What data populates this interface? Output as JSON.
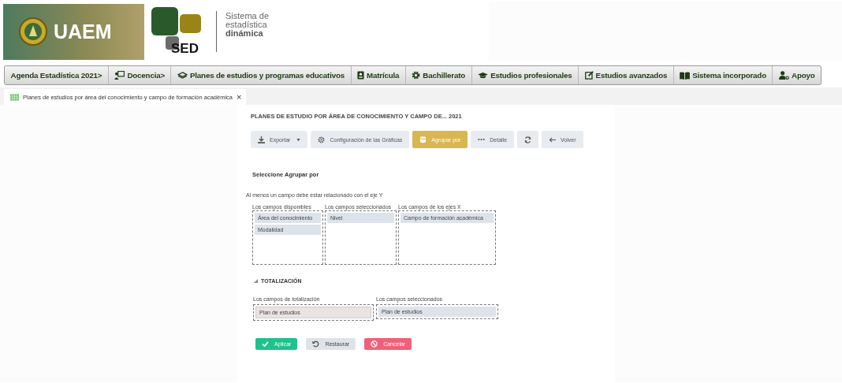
{
  "header": {
    "logo_text": "UAEM",
    "sed_text": "SED",
    "system_name_lines": [
      "Sistema de",
      "estadística"
    ],
    "system_name_bold": "dinámica"
  },
  "nav": [
    {
      "label": "Agenda Estadística 2021>"
    },
    {
      "label": "Docencia>"
    },
    {
      "label": "Planes de estudios y programas educativos"
    },
    {
      "label": "Matrícula"
    },
    {
      "label": "Bachillerato"
    },
    {
      "label": "Estudios profesionales"
    },
    {
      "label": "Estudios avanzados"
    },
    {
      "label": "Sistema incorporado"
    },
    {
      "label": "Apoyo"
    }
  ],
  "tabs": [
    {
      "label": "Planes de estudios por área del conocimiento y campo de formación académica",
      "selected": true,
      "close": "×"
    }
  ],
  "report": {
    "title": "PLANES DE ESTUDIO POR ÁREA DE CONOCIMIENTO Y CAMPO DE... 2021"
  },
  "toolbar": [
    {
      "kind": "dropdown",
      "label": "Exportar",
      "selected": false
    },
    {
      "kind": "button",
      "label": "Configuración de las Gráficas",
      "selected": false
    },
    {
      "kind": "button",
      "label": "Agrupar por",
      "selected": true
    },
    {
      "kind": "button",
      "label": "Detalle",
      "selected": false
    },
    {
      "kind": "icon",
      "selected": false
    },
    {
      "kind": "button",
      "label": "Volver",
      "selected": false
    }
  ],
  "group_by": {
    "heading": "Seleccione Agrupar por",
    "note": "Al menos un campo debe estar relacionado con el eje Y",
    "lists": [
      {
        "label": "Los campos disponibles",
        "items": [
          "Área del conocimiento",
          "Modalidad"
        ]
      },
      {
        "label": "Los campos seleccionados",
        "items": [
          "Nivel"
        ]
      },
      {
        "label": "Los campos de los ejes X",
        "items": [
          "Campo de formación académica"
        ]
      }
    ]
  },
  "totals": {
    "heading": "TOTALIZACIÓN",
    "expanded": true,
    "lists": [
      {
        "label": "Los campos de totalización",
        "items": [
          "Plan de estudios"
        ]
      },
      {
        "label": "Los campos seleccionados",
        "items": [
          "Plan de estudios"
        ]
      }
    ]
  },
  "actions": [
    {
      "kind": "apply",
      "label": "Aplicar"
    },
    {
      "kind": "reset",
      "label": "Restaurar"
    },
    {
      "kind": "cancel",
      "label": "Cancelar"
    }
  ]
}
